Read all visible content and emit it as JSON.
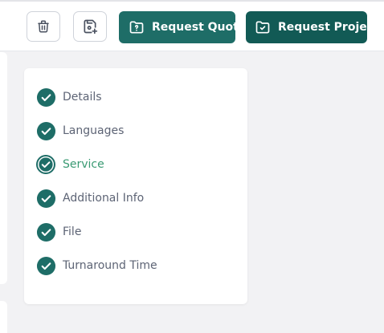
{
  "toolbar": {
    "delete_icon": "trash-icon",
    "save_icon": "save-plus-icon",
    "request_quote_label": "Request Quote",
    "request_quote_icon": "folder-question-icon",
    "request_project_label": "Request Project",
    "request_project_icon": "folder-check-icon"
  },
  "steps": [
    {
      "label": "Details",
      "status": "completed"
    },
    {
      "label": "Languages",
      "status": "completed"
    },
    {
      "label": "Service",
      "status": "current"
    },
    {
      "label": "Additional Info",
      "status": "completed"
    },
    {
      "label": "File",
      "status": "completed"
    },
    {
      "label": "Turnaround Time",
      "status": "completed"
    }
  ],
  "colors": {
    "primary": "#1e6d67",
    "primary_dark": "#125a55",
    "active_text": "#3a9a73",
    "step_text": "#5d6475",
    "background": "#f2f2f4"
  }
}
